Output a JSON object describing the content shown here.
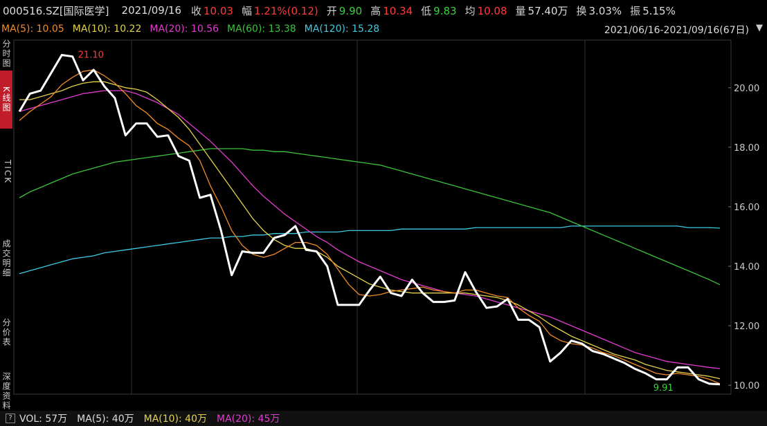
{
  "header": {
    "code": "000516.SZ[国际医学]",
    "date": "2021/09/16",
    "quotes": [
      {
        "label": "收",
        "value": "10.03",
        "color": "red"
      },
      {
        "label": "幅",
        "value": "1.21%(0.12)",
        "color": "red"
      },
      {
        "label": "开",
        "value": "9.90",
        "color": "green"
      },
      {
        "label": "高",
        "value": "10.34",
        "color": "red"
      },
      {
        "label": "低",
        "value": "9.83",
        "color": "green"
      },
      {
        "label": "均",
        "value": "10.08",
        "color": "red"
      },
      {
        "label": "量",
        "value": "57.40万",
        "color": "white"
      },
      {
        "label": "换",
        "value": "3.03%",
        "color": "white"
      },
      {
        "label": "振",
        "value": "5.15%",
        "color": "white"
      }
    ]
  },
  "ma_bar": [
    {
      "text": "MA(5): 10.05",
      "color": "#f28c28"
    },
    {
      "text": "MA(10): 10.22",
      "color": "#e6d34a"
    },
    {
      "text": "MA(20): 10.56",
      "color": "#e33bd0"
    },
    {
      "text": "MA(60): 13.38",
      "color": "#3cc43c"
    },
    {
      "text": "MA(120): 15.28",
      "color": "#3ecbe6"
    }
  ],
  "date_range": "2021/06/16-2021/09/16(67日)",
  "range_button": "▼",
  "sidebar": [
    "分时图",
    "K线图",
    "TICK",
    "成交明细",
    "分价表",
    "深度资料"
  ],
  "vol_bar": {
    "button": "?",
    "items": [
      {
        "text": "VOL: 57万",
        "color": "#ddd"
      },
      {
        "text": "MA(5): 40万",
        "color": "#ddd"
      },
      {
        "text": "MA(10): 40万",
        "color": "#e6d34a"
      },
      {
        "text": "MA(20): 45万",
        "color": "#e33bd0"
      }
    ]
  },
  "chart_data": {
    "type": "line",
    "y_ticks": [
      "20.00",
      "18.00",
      "16.00",
      "14.00",
      "12.00",
      "10.00"
    ],
    "ylim": [
      9.7,
      21.6
    ],
    "n": 67,
    "annotations": [
      {
        "text": "21.10",
        "index": 5,
        "value": 21.1,
        "color": "#ff3b3b"
      },
      {
        "text": "9.91",
        "index": 62,
        "value": 9.91,
        "color": "#3bd23b"
      }
    ],
    "series": [
      {
        "name": "Close",
        "color": "#ffffff",
        "values": [
          19.2,
          19.8,
          19.9,
          20.5,
          21.1,
          21.05,
          20.25,
          20.6,
          20.05,
          19.65,
          18.4,
          18.8,
          18.8,
          18.35,
          18.4,
          17.7,
          17.55,
          16.3,
          16.4,
          15.2,
          13.7,
          14.5,
          14.45,
          14.45,
          14.95,
          15.05,
          15.35,
          14.55,
          14.5,
          14.0,
          12.7,
          12.7,
          12.7,
          13.2,
          13.65,
          13.1,
          13.0,
          13.55,
          13.1,
          12.8,
          12.8,
          12.85,
          13.8,
          13.15,
          12.6,
          12.65,
          12.9,
          12.2,
          12.2,
          11.95,
          10.8,
          11.1,
          11.5,
          11.4,
          11.15,
          11.05,
          10.9,
          10.75,
          10.55,
          10.4,
          10.2,
          10.2,
          10.6,
          10.6,
          10.2,
          10.05,
          10.03
        ]
      },
      {
        "name": "MA(5)",
        "color": "#f28c28",
        "values": [
          18.9,
          19.2,
          19.45,
          19.7,
          20.1,
          20.35,
          20.55,
          20.6,
          20.4,
          20.15,
          19.8,
          19.4,
          19.15,
          18.8,
          18.6,
          18.3,
          18.05,
          17.55,
          16.7,
          16.0,
          15.2,
          14.7,
          14.4,
          14.3,
          14.4,
          14.6,
          14.8,
          14.8,
          14.7,
          14.4,
          13.9,
          13.4,
          13.05,
          13.0,
          13.05,
          13.15,
          13.2,
          13.25,
          13.3,
          13.2,
          13.15,
          13.1,
          13.2,
          13.2,
          13.1,
          13.0,
          12.95,
          12.6,
          12.35,
          12.15,
          11.7,
          11.5,
          11.4,
          11.35,
          11.25,
          11.1,
          11.0,
          10.85,
          10.7,
          10.55,
          10.4,
          10.35,
          10.4,
          10.35,
          10.3,
          10.2,
          10.05
        ]
      },
      {
        "name": "MA(10)",
        "color": "#e6d34a",
        "values": [
          19.6,
          19.6,
          19.7,
          19.8,
          19.9,
          20.05,
          20.15,
          20.2,
          20.2,
          20.1,
          20.0,
          19.95,
          19.85,
          19.6,
          19.3,
          19.0,
          18.6,
          18.1,
          17.6,
          17.1,
          16.6,
          16.1,
          15.6,
          15.2,
          14.9,
          14.7,
          14.6,
          14.6,
          14.5,
          14.3,
          14.0,
          13.8,
          13.6,
          13.4,
          13.3,
          13.2,
          13.15,
          13.1,
          13.1,
          13.1,
          13.1,
          13.1,
          13.1,
          13.05,
          13.0,
          12.95,
          12.85,
          12.7,
          12.5,
          12.3,
          12.05,
          11.85,
          11.65,
          11.5,
          11.35,
          11.2,
          11.05,
          10.95,
          10.85,
          10.7,
          10.6,
          10.5,
          10.45,
          10.4,
          10.35,
          10.3,
          10.22
        ]
      },
      {
        "name": "MA(20)",
        "color": "#e33bd0",
        "values": [
          19.2,
          19.3,
          19.4,
          19.5,
          19.6,
          19.7,
          19.8,
          19.85,
          19.9,
          19.9,
          19.9,
          19.8,
          19.65,
          19.5,
          19.3,
          19.1,
          18.8,
          18.5,
          18.2,
          17.85,
          17.5,
          17.1,
          16.7,
          16.35,
          16.05,
          15.75,
          15.5,
          15.25,
          15.0,
          14.8,
          14.55,
          14.35,
          14.15,
          14.0,
          13.85,
          13.7,
          13.55,
          13.45,
          13.35,
          13.25,
          13.15,
          13.1,
          13.05,
          13.0,
          12.9,
          12.8,
          12.7,
          12.6,
          12.5,
          12.4,
          12.3,
          12.15,
          12.0,
          11.85,
          11.7,
          11.55,
          11.4,
          11.25,
          11.1,
          11.0,
          10.9,
          10.8,
          10.75,
          10.7,
          10.65,
          10.6,
          10.56
        ]
      },
      {
        "name": "MA(60)",
        "color": "#3cc43c",
        "values": [
          16.3,
          16.5,
          16.65,
          16.8,
          16.95,
          17.1,
          17.2,
          17.3,
          17.4,
          17.5,
          17.55,
          17.6,
          17.65,
          17.7,
          17.75,
          17.8,
          17.85,
          17.9,
          17.95,
          17.95,
          17.95,
          17.95,
          17.9,
          17.9,
          17.85,
          17.85,
          17.8,
          17.75,
          17.7,
          17.65,
          17.6,
          17.55,
          17.5,
          17.45,
          17.4,
          17.3,
          17.2,
          17.1,
          17.0,
          16.9,
          16.8,
          16.7,
          16.6,
          16.5,
          16.4,
          16.3,
          16.2,
          16.1,
          16.0,
          15.9,
          15.8,
          15.65,
          15.5,
          15.35,
          15.2,
          15.05,
          14.9,
          14.75,
          14.6,
          14.45,
          14.3,
          14.15,
          14.0,
          13.85,
          13.7,
          13.55,
          13.38
        ]
      },
      {
        "name": "MA(120)",
        "color": "#3ecbe6",
        "values": [
          13.75,
          13.85,
          13.95,
          14.05,
          14.15,
          14.25,
          14.3,
          14.35,
          14.45,
          14.5,
          14.55,
          14.6,
          14.65,
          14.7,
          14.75,
          14.8,
          14.85,
          14.9,
          14.95,
          14.95,
          15.0,
          15.0,
          15.05,
          15.05,
          15.1,
          15.1,
          15.1,
          15.15,
          15.15,
          15.15,
          15.15,
          15.2,
          15.2,
          15.2,
          15.2,
          15.2,
          15.25,
          15.25,
          15.25,
          15.25,
          15.25,
          15.25,
          15.25,
          15.3,
          15.3,
          15.3,
          15.3,
          15.3,
          15.3,
          15.3,
          15.3,
          15.3,
          15.35,
          15.35,
          15.35,
          15.35,
          15.35,
          15.35,
          15.35,
          15.35,
          15.35,
          15.35,
          15.35,
          15.3,
          15.3,
          15.3,
          15.28
        ]
      }
    ]
  }
}
